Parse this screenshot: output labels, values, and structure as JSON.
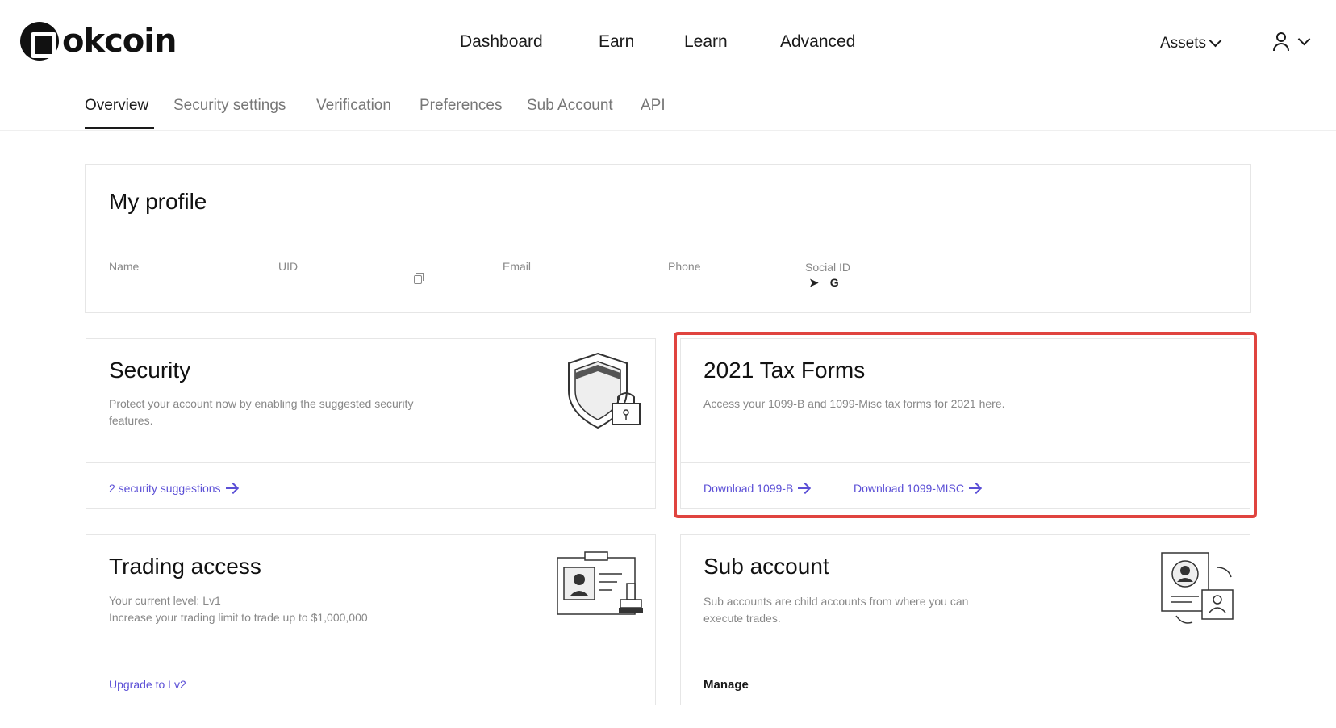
{
  "brand": {
    "name": "okcoin"
  },
  "nav": {
    "items": [
      "Dashboard",
      "Earn",
      "Learn",
      "Advanced"
    ],
    "assets_label": "Assets"
  },
  "tabs": [
    "Overview",
    "Security settings",
    "Verification",
    "Preferences",
    "Sub Account",
    "API"
  ],
  "active_tab": "Overview",
  "profile": {
    "title": "My profile",
    "fields": {
      "name": "Name",
      "uid": "UID",
      "email": "Email",
      "phone": "Phone",
      "social": "Social ID"
    },
    "social_icons": [
      "telegram-icon",
      "google-icon"
    ]
  },
  "security": {
    "title": "Security",
    "description": "Protect your account now by enabling the suggested security features.",
    "link": "2 security suggestions"
  },
  "tax": {
    "title": "2021 Tax Forms",
    "description": "Access your 1099-B and 1099-Misc tax forms for 2021 here.",
    "link_b": "Download 1099-B",
    "link_misc": "Download 1099-MISC",
    "highlight_color": "#e0443f"
  },
  "trading": {
    "title": "Trading access",
    "level": "Your current level: Lv1",
    "limit": "Increase your trading limit to trade up to $1,000,000",
    "link": "Upgrade to Lv2"
  },
  "subaccount": {
    "title": "Sub account",
    "description": "Sub accounts are child accounts from where you can execute trades.",
    "link": "Manage"
  },
  "colors": {
    "link": "#5b4fd6",
    "text": "#1a1a1a",
    "muted": "#888888"
  }
}
